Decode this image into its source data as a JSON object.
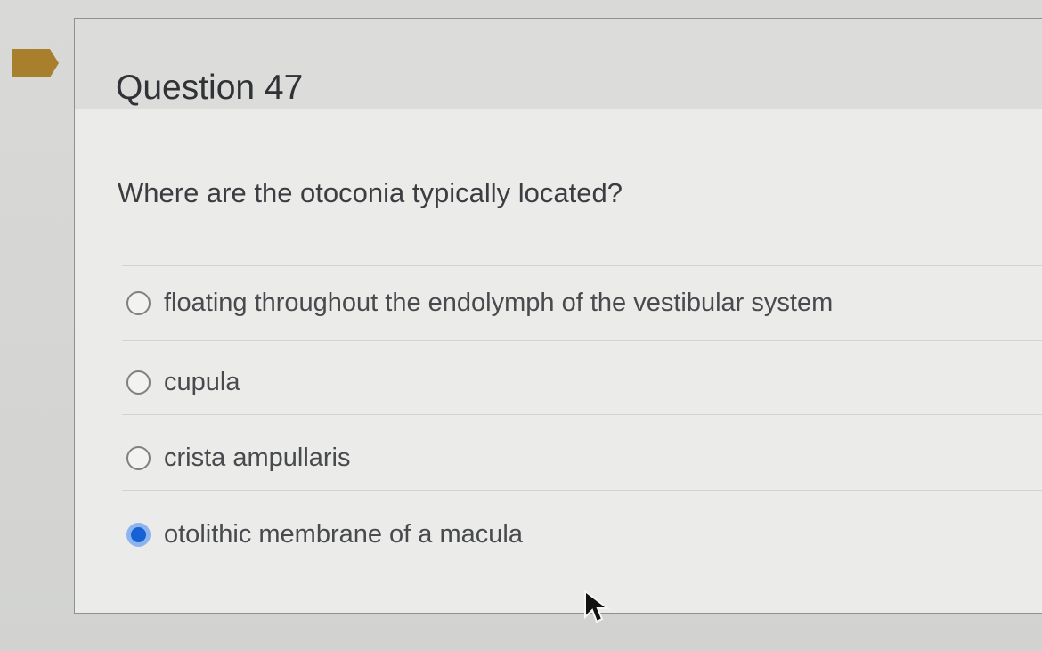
{
  "question": {
    "title": "Question 47",
    "prompt": "Where are the otoconia typically located?",
    "options": [
      {
        "label": "floating throughout the endolymph of the vestibular system",
        "selected": false
      },
      {
        "label": "cupula",
        "selected": false
      },
      {
        "label": "crista ampullaris",
        "selected": false
      },
      {
        "label": "otolithic membrane of a macula",
        "selected": true
      }
    ]
  },
  "colors": {
    "flag": "#a87f2d",
    "selected_radio": "#1661d3"
  },
  "icons": {
    "flag": "bookmark-flag-icon",
    "cursor": "mouse-pointer-icon"
  }
}
